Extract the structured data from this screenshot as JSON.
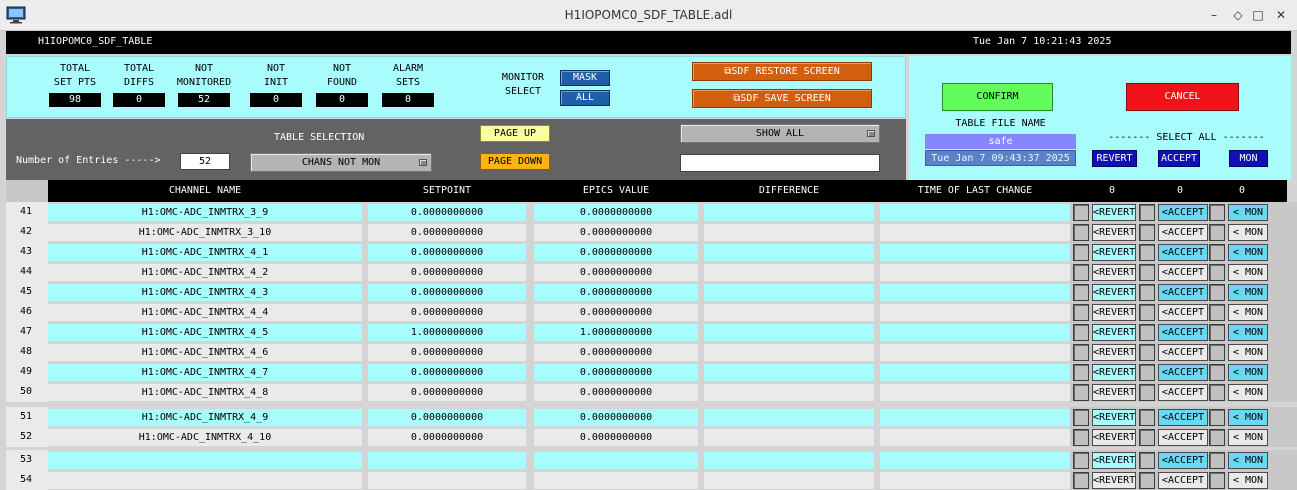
{
  "window": {
    "title": "H1IOPOMC0_SDF_TABLE.adl",
    "minimize": "–",
    "restore": "◇",
    "maximize": "□",
    "close": "✕"
  },
  "header": {
    "title": "H1IOPOMC0_SDF_TABLE",
    "datetime": "Tue Jan  7 10:21:43 2025"
  },
  "stats": [
    {
      "l1": "TOTAL",
      "l2": "SET PTS",
      "value": "98"
    },
    {
      "l1": "TOTAL",
      "l2": "DIFFS",
      "value": "0"
    },
    {
      "l1": "NOT",
      "l2": "MONITORED",
      "value": "52"
    },
    {
      "l1": "NOT",
      "l2": "INIT",
      "value": "0"
    },
    {
      "l1": "NOT",
      "l2": "FOUND",
      "value": "0"
    },
    {
      "l1": "ALARM",
      "l2": "SETS",
      "value": "0"
    }
  ],
  "monitor_select": {
    "line1": "MONITOR",
    "line2": "SELECT",
    "mask": "MASK",
    "all": "ALL"
  },
  "sdf_restore": "⧉SDF RESTORE SCREEN",
  "sdf_save": "⧉SDF SAVE SCREEN",
  "confirm": "CONFIRM",
  "cancel": "CANCEL",
  "table_file": {
    "label": "TABLE FILE NAME",
    "value": "safe",
    "time": "Tue Jan  7 09:43:37 2025"
  },
  "select_all": {
    "label": "------- SELECT ALL -------",
    "revert": "REVERT",
    "accept": "ACCEPT",
    "mon": "MON"
  },
  "controls": {
    "entries_label": "Number of Entries ----->",
    "entries_value": "52",
    "table_selection_label": "TABLE SELECTION",
    "table_selection_value": "CHANS NOT MON",
    "page_up": "PAGE UP",
    "page_down": "PAGE DOWN",
    "show_all": "SHOW ALL",
    "filter_value": ""
  },
  "columns": {
    "name": "CHANNEL NAME",
    "setpoint": "SETPOINT",
    "epics": "EPICS VALUE",
    "diff": "DIFFERENCE",
    "time": "TIME OF LAST CHANGE",
    "count_revert": "0",
    "count_accept": "0",
    "count_mon": "0"
  },
  "row_buttons": {
    "revert": "<REVERT",
    "accept": "<ACCEPT",
    "mon": "< MON"
  },
  "rows": [
    {
      "idx": "41",
      "name": "H1:OMC-ADC_INMTRX_3_9",
      "setpoint": "0.0000000000",
      "epics": "0.0000000000",
      "diff": "",
      "time": ""
    },
    {
      "idx": "42",
      "name": "H1:OMC-ADC_INMTRX_3_10",
      "setpoint": "0.0000000000",
      "epics": "0.0000000000",
      "diff": "",
      "time": ""
    },
    {
      "idx": "43",
      "name": "H1:OMC-ADC_INMTRX_4_1",
      "setpoint": "0.0000000000",
      "epics": "0.0000000000",
      "diff": "",
      "time": ""
    },
    {
      "idx": "44",
      "name": "H1:OMC-ADC_INMTRX_4_2",
      "setpoint": "0.0000000000",
      "epics": "0.0000000000",
      "diff": "",
      "time": ""
    },
    {
      "idx": "45",
      "name": "H1:OMC-ADC_INMTRX_4_3",
      "setpoint": "0.0000000000",
      "epics": "0.0000000000",
      "diff": "",
      "time": ""
    },
    {
      "idx": "46",
      "name": "H1:OMC-ADC_INMTRX_4_4",
      "setpoint": "0.0000000000",
      "epics": "0.0000000000",
      "diff": "",
      "time": ""
    },
    {
      "idx": "47",
      "name": "H1:OMC-ADC_INMTRX_4_5",
      "setpoint": "1.0000000000",
      "epics": "1.0000000000",
      "diff": "",
      "time": ""
    },
    {
      "idx": "48",
      "name": "H1:OMC-ADC_INMTRX_4_6",
      "setpoint": "0.0000000000",
      "epics": "0.0000000000",
      "diff": "",
      "time": ""
    },
    {
      "idx": "49",
      "name": "H1:OMC-ADC_INMTRX_4_7",
      "setpoint": "0.0000000000",
      "epics": "0.0000000000",
      "diff": "",
      "time": ""
    },
    {
      "idx": "50",
      "name": "H1:OMC-ADC_INMTRX_4_8",
      "setpoint": "0.0000000000",
      "epics": "0.0000000000",
      "diff": "",
      "time": ""
    },
    {
      "idx": "51",
      "name": "H1:OMC-ADC_INMTRX_4_9",
      "setpoint": "0.0000000000",
      "epics": "0.0000000000",
      "diff": "",
      "time": ""
    },
    {
      "idx": "52",
      "name": "H1:OMC-ADC_INMTRX_4_10",
      "setpoint": "0.0000000000",
      "epics": "0.0000000000",
      "diff": "",
      "time": ""
    },
    {
      "idx": "53",
      "name": "",
      "setpoint": "",
      "epics": "",
      "diff": "",
      "time": ""
    },
    {
      "idx": "54",
      "name": "",
      "setpoint": "",
      "epics": "",
      "diff": "",
      "time": ""
    }
  ],
  "icons": {
    "app": "monitor-icon",
    "dropdown": "dropdown-arrow-icon",
    "checkbox": "checkbox-icon"
  }
}
